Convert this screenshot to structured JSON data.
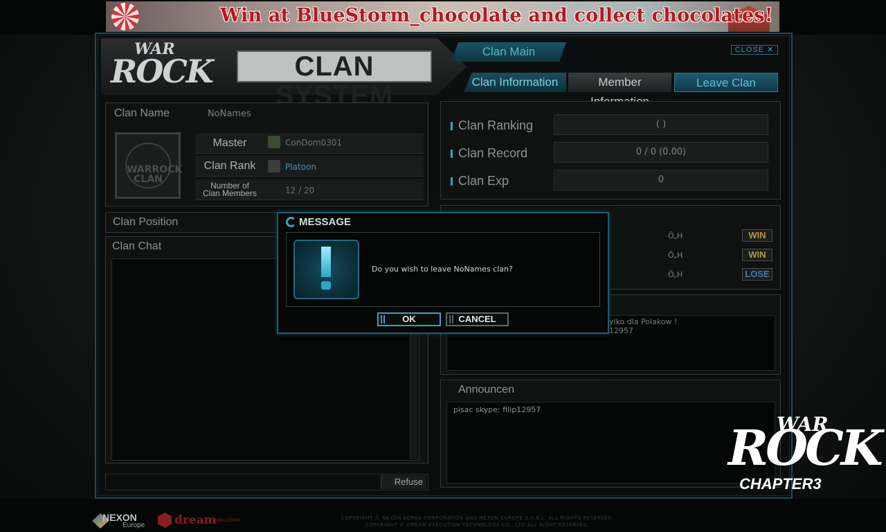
{
  "banner": {
    "text": "Win at BlueStorm_chocolate and collect chocolates!"
  },
  "header": {
    "logo_small_top": "WAR",
    "logo_small_bottom": "ROCK",
    "title": "CLAN SYSTEM",
    "close_label": "CLOSE"
  },
  "tabs": {
    "main": "Clan Main",
    "info": "Clan Information",
    "member": "Member Information",
    "leave": "Leave Clan"
  },
  "clan_info": {
    "name_label": "Clan Name",
    "name_value": "NoNames",
    "emblem_text": "WARROCK CLAN",
    "master_label": "Master",
    "master_value": "ConDom0301",
    "rank_label": "Clan Rank",
    "rank_value": "Platoon",
    "members_label_1": "Number of",
    "members_label_2": "Clan Members",
    "members_value": "12 / 20"
  },
  "position": {
    "label": "Clan Position"
  },
  "chat": {
    "label": "Clan Chat",
    "refuse_label": "Refuse"
  },
  "stats": {
    "ranking_label": "Clan Ranking",
    "ranking_value": "(           )",
    "record_label": "Clan Record",
    "record_value": "0 / 0 (0.00)",
    "exp_label": "Clan Exp",
    "exp_value": "0"
  },
  "matches": [
    {
      "opponent": "Ö„H",
      "result": "WIN"
    },
    {
      "opponent": "Ö„H",
      "result": "WIN"
    },
    {
      "opponent": "Ö„H",
      "result": "LOSE"
    }
  ],
  "intro": {
    "line1": "ylko dla Polakow !",
    "line2": "12957"
  },
  "announcement": {
    "label": "Announcen",
    "text": "pisac skype: filip12957"
  },
  "dialog": {
    "title": "MESSAGE",
    "message": "Do you wish to leave NoNames clan?",
    "ok_label": "OK",
    "cancel_label": "CANCEL"
  },
  "brand": {
    "logo_top": "WAR",
    "logo_bottom": "ROCK",
    "chapter": "CHAPTER3"
  },
  "footer": {
    "nexon": "NEXON",
    "nexon_sub": "Europe",
    "dream": "dream",
    "dream_sub": "execution",
    "copyright_1": "COPYRIGHT © NEXON KOREA CORPORATION AND NEXON EUROPE S.A.R.L. ALL RIGHTS RESERVED.",
    "copyright_2": "COPYRIGHT © DREAM EXECUTION TECHNOLOGY CO., LTD ALL RIGHT RESERVED."
  },
  "colors": {
    "accent": "#3aa3be",
    "win": "#b39a44",
    "lose": "#3b7fae",
    "banner_text": "#b11a23"
  }
}
